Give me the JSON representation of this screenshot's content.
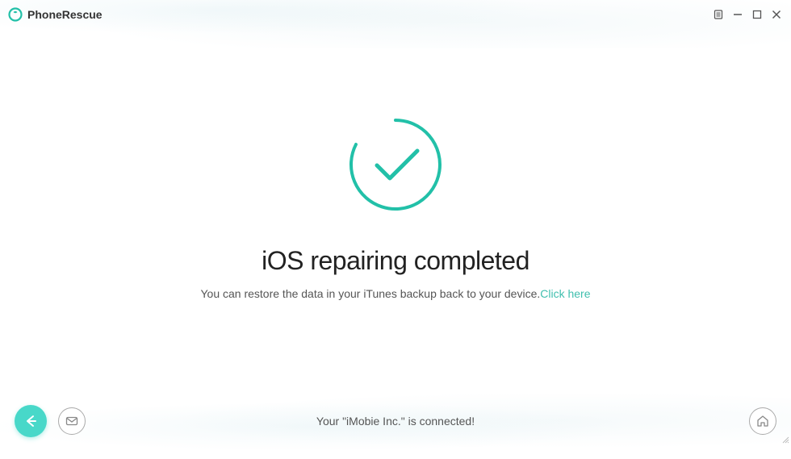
{
  "header": {
    "app_title": "PhoneRescue"
  },
  "main": {
    "heading": "iOS repairing completed",
    "description": "You can restore the data in your iTunes backup back to your device.",
    "link_text": "Click here"
  },
  "footer": {
    "status": "Your \"iMobie Inc.\" is connected!"
  },
  "colors": {
    "accent": "#22c0a8",
    "accent_light": "#48d8c9"
  }
}
